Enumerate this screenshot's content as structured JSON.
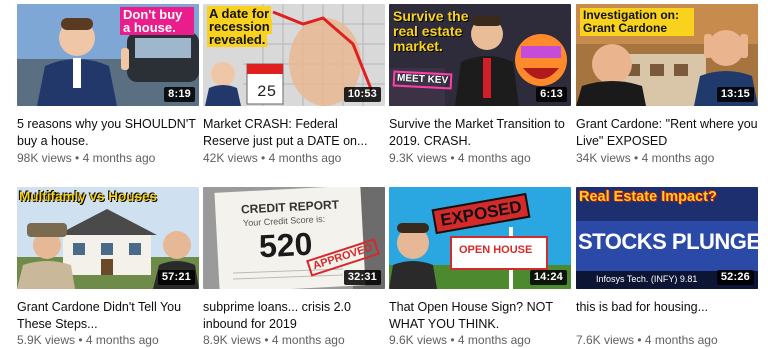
{
  "videos": [
    {
      "title": "5 reasons why you SHOULDN'T buy a house.",
      "views": "98K views",
      "age": "4 months ago",
      "duration": "8:19",
      "overlay": "Don't buy a house."
    },
    {
      "title": "Market CRASH: Federal Reserve just put a DATE on...",
      "views": "42K views",
      "age": "4 months ago",
      "duration": "10:53",
      "overlay": "A date for recession revealed.",
      "calendar_day": "25"
    },
    {
      "title": "Survive the Market Transition to 2019. CRASH.",
      "views": "9.3K views",
      "age": "4 months ago",
      "duration": "6:13",
      "overlay": "Survive the real estate market.",
      "sign_text": "MEET KEV"
    },
    {
      "title": "Grant Cardone: \"Rent where you Live\" EXPOSED",
      "views": "34K views",
      "age": "4 months ago",
      "duration": "13:15",
      "overlay": "Investigation on: Grant Cardone"
    },
    {
      "title": "Grant Cardone Didn't Tell You These Steps...",
      "views": "5.9K views",
      "age": "4 months ago",
      "duration": "57:21",
      "overlay": "Multifamly vs Houses"
    },
    {
      "title": "subprime loans... crisis 2.0 inbound for 2019",
      "views": "8.9K views",
      "age": "4 months ago",
      "duration": "32:31",
      "overlay_heading": "CREDIT REPORT",
      "overlay_sub": "Your Credit Score is:",
      "overlay_score": "520",
      "overlay_stamp": "APPROVED"
    },
    {
      "title": "That Open House Sign? NOT WHAT YOU THINK.",
      "views": "9.6K views",
      "age": "4 months ago",
      "duration": "14:24",
      "overlay": "EXPOSED",
      "sign_text": "OPEN HOUSE"
    },
    {
      "title": "this is bad for housing...",
      "views": "7.6K views",
      "age": "4 months ago",
      "duration": "52:26",
      "overlay": "Real Estate Impact?",
      "ticker_main": "STOCKS PLUNGE",
      "ticker_sub": "Infosys Tech. (INFY) 9.81"
    }
  ]
}
